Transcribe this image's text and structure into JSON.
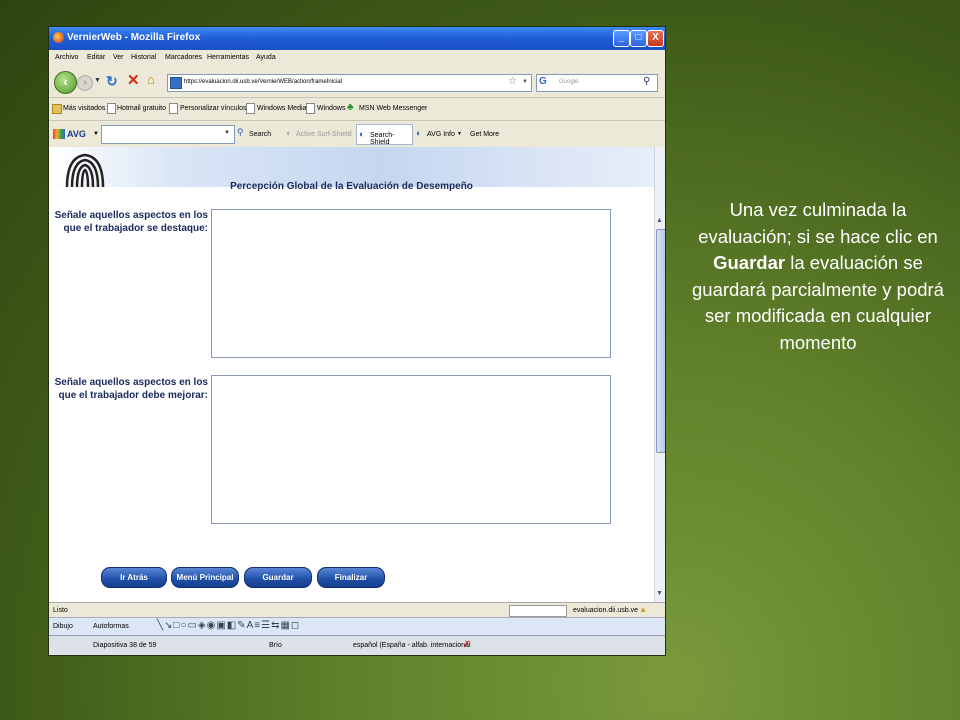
{
  "window": {
    "title": "VernierWeb - Mozilla Firefox",
    "min_label": "_",
    "max_label": "□",
    "close_label": "X"
  },
  "menu": [
    "Archivo",
    "Editar",
    "Ver",
    "Historial",
    "Marcadores",
    "Herramientas",
    "Ayuda"
  ],
  "nav": {
    "url": "https://evaluacion.dii.usb.ve/VernierWEB/action/frameInicial",
    "search_placeholder": "Google",
    "search_engine_glyph": "G"
  },
  "bookmarks": [
    "Más visitados",
    "Hotmail gratuito",
    "Personalizar vínculos",
    "Windows Media",
    "Windows",
    "MSN Web Messenger"
  ],
  "avg": {
    "logo": "AVG",
    "search": "Search",
    "surf_shield": "Active Surf-Shield",
    "search_shield": "Search-Shield",
    "avg_info": "AVG Info",
    "get_more": "Get More"
  },
  "page": {
    "section_title": "Percepción Global de la Evaluación de Desempeño",
    "field1_label_line1": "Señale aquellos aspectos en los",
    "field1_label_line2": "que el trabajador se destaque:",
    "field2_label_line1": "Señale aquellos aspectos en los",
    "field2_label_line2": "que el trabajador debe mejorar:",
    "buttons": {
      "back": "Ir Atrás",
      "main_menu": "Menú Principal",
      "save": "Guardar",
      "finish": "Finalizar"
    }
  },
  "status": {
    "text": "Listo",
    "domain": "evaluacion.dii.usb.ve"
  },
  "drawing_toolbar": {
    "draw": "Dibujo",
    "autoshapes": "Autoformas"
  },
  "ppt_status": {
    "slide": "Diapositiva 38 de 59",
    "design": "Brío",
    "language": "español (España - alfab. internacional"
  },
  "note": {
    "before": "Una vez culminada la evaluación; si se hace clic en ",
    "bold": "Guardar",
    "after": " la evaluación se guardará parcialmente y podrá ser modificada en cualquier momento"
  }
}
